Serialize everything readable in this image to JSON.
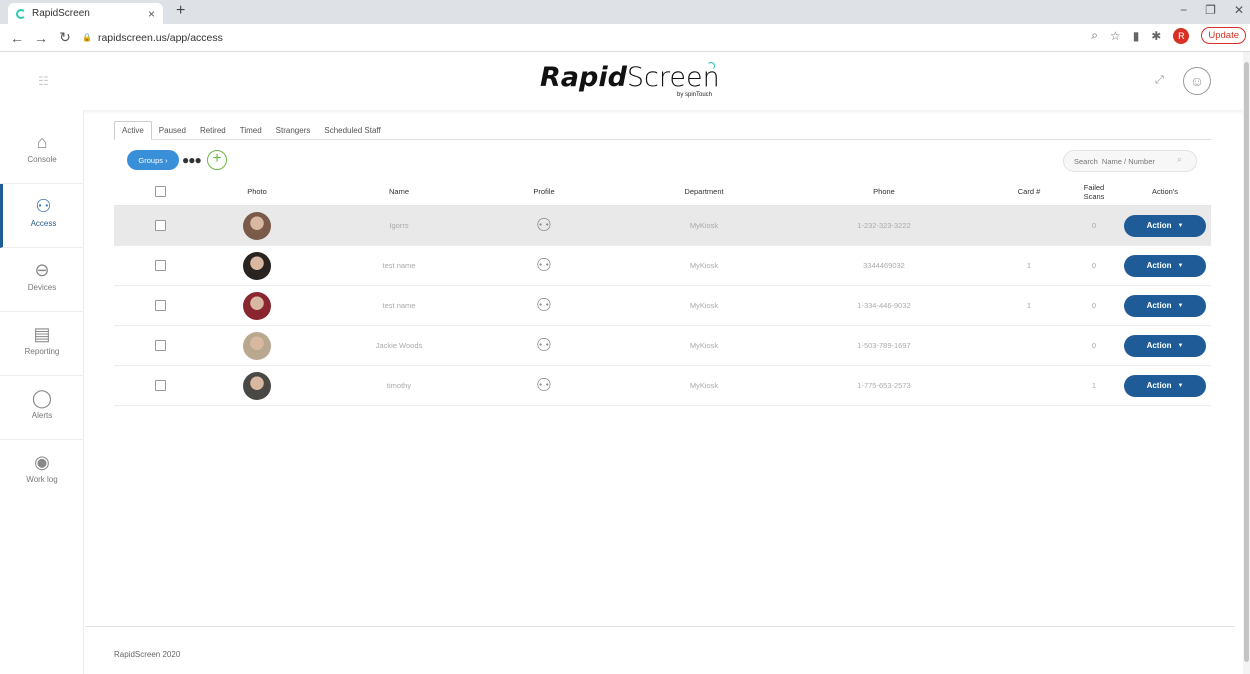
{
  "browser": {
    "tab_title": "RapidScreen",
    "tab_close": "×",
    "new_tab": "+",
    "url": "rapidscreen.us/app/access",
    "profile_initial": "R",
    "update_label": "Update"
  },
  "header": {
    "logo_bold": "Rapid",
    "logo_light": "Screen",
    "logo_sub": "by spinTouch"
  },
  "sidebar": {
    "items": [
      {
        "label": "Console",
        "icon": "home-icon"
      },
      {
        "label": "Access",
        "icon": "users-icon"
      },
      {
        "label": "Devices",
        "icon": "device-icon"
      },
      {
        "label": "Reporting",
        "icon": "report-icon"
      },
      {
        "label": "Alerts",
        "icon": "chat-bubble-icon"
      },
      {
        "label": "Work log",
        "icon": "eye-icon"
      }
    ]
  },
  "tabs": [
    "Active",
    "Paused",
    "Retired",
    "Timed",
    "Strangers",
    "Scheduled Staff"
  ],
  "toolbar": {
    "groups_label": "Groups ›",
    "search_placeholder": "Search  Name / Number"
  },
  "table": {
    "headers": {
      "photo": "Photo",
      "name": "Name",
      "profile": "Profile",
      "department": "Department",
      "phone": "Phone",
      "card": "Card #",
      "failed": "Failed Scans",
      "actions": "Action's"
    },
    "rows": [
      {
        "name": "Igorrs",
        "department": "MyKiosk",
        "phone": "1-232-323-3222",
        "card": "",
        "failed": "0",
        "action": "Action",
        "photo_color": "#7a5a48"
      },
      {
        "name": "test name",
        "department": "MyKiosk",
        "phone": "3344469032",
        "card": "1",
        "failed": "0",
        "action": "Action",
        "photo_color": "#2a2420"
      },
      {
        "name": "test name",
        "department": "MyKiosk",
        "phone": "1-334-446-9032",
        "card": "1",
        "failed": "0",
        "action": "Action",
        "photo_color": "#8a2630"
      },
      {
        "name": "Jackie Woods",
        "department": "MyKiosk",
        "phone": "1-503-789-1697",
        "card": "",
        "failed": "0",
        "action": "Action",
        "photo_color": "#b9a890"
      },
      {
        "name": "timothy",
        "department": "MyKiosk",
        "phone": "1-775-653-2573",
        "card": "",
        "failed": "1",
        "action": "Action",
        "photo_color": "#4a4844"
      }
    ]
  },
  "footer": {
    "text": "RapidScreen 2020"
  },
  "colors": {
    "primary": "#1f5c97",
    "groups": "#3a8fd9",
    "add": "#6bb844",
    "accent": "#2ec9b5"
  }
}
